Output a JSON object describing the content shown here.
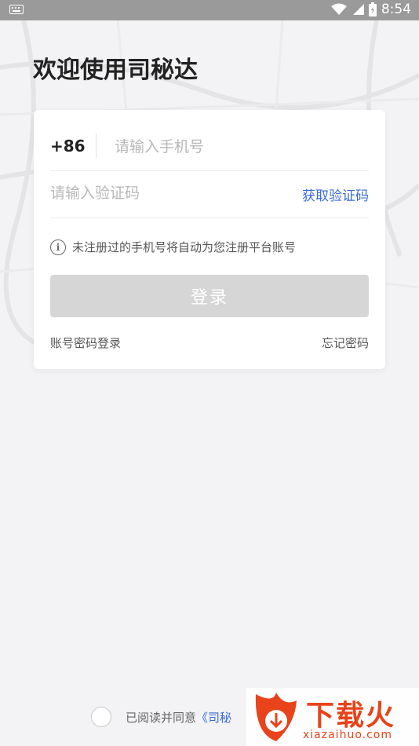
{
  "status_bar": {
    "time": "8:54"
  },
  "page": {
    "title": "欢迎使用司秘达"
  },
  "form": {
    "country_code": "+86",
    "phone_placeholder": "请输入手机号",
    "code_placeholder": "请输入验证码",
    "get_code_label": "获取验证码",
    "hint": "未注册过的手机号将自动为您注册平台账号",
    "login_label": "登录",
    "password_login_label": "账号密码登录",
    "forgot_label": "忘记密码"
  },
  "agreement": {
    "text": "已阅读并同意",
    "link": "《司秘"
  },
  "watermark": {
    "title": "下载火",
    "url": "xiazaihuo.com"
  },
  "colors": {
    "accent": "#3a6bd8",
    "button_disabled": "#d6d6d6",
    "watermark": "#e8431a"
  }
}
